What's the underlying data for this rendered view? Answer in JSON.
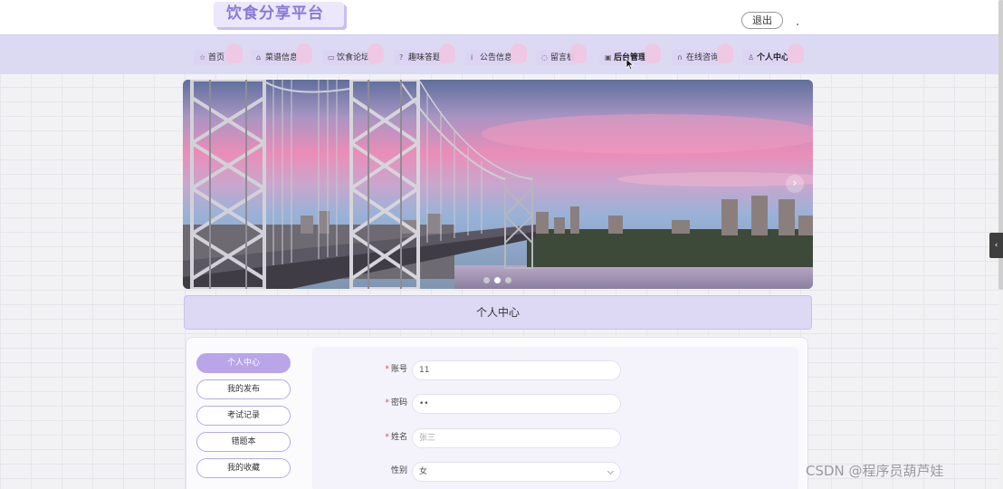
{
  "header": {
    "logo_text": "饮食分享平台",
    "logout_label": "退出"
  },
  "nav": {
    "items": [
      {
        "icon": "star-icon",
        "glyph": "☆",
        "label": "首页"
      },
      {
        "icon": "home-icon",
        "glyph": "⌂",
        "label": "菜谱信息"
      },
      {
        "icon": "chat-icon",
        "glyph": "▭",
        "label": "饮食论坛"
      },
      {
        "icon": "question-icon",
        "glyph": "?",
        "label": "趣味答题"
      },
      {
        "icon": "info-icon",
        "glyph": "i",
        "label": "公告信息"
      },
      {
        "icon": "message-icon",
        "glyph": "◌",
        "label": "留言板"
      },
      {
        "icon": "admin-icon",
        "glyph": "▣",
        "label": "后台管理"
      },
      {
        "icon": "service-icon",
        "glyph": "∩",
        "label": "在线咨询"
      },
      {
        "icon": "user-icon",
        "glyph": "♙",
        "label": "个人中心"
      }
    ]
  },
  "banner": {
    "next_arrow": "›",
    "dots": 3,
    "active_dot": 2
  },
  "section": {
    "title": "个人中心"
  },
  "sidebar": {
    "items": [
      {
        "label": "个人中心",
        "active": true
      },
      {
        "label": "我的发布",
        "active": false
      },
      {
        "label": "考试记录",
        "active": false
      },
      {
        "label": "错题本",
        "active": false
      },
      {
        "label": "我的收藏",
        "active": false
      }
    ]
  },
  "form": {
    "fields": [
      {
        "label": "账号",
        "required": true,
        "value": "11"
      },
      {
        "label": "密码",
        "required": true,
        "value": "••"
      },
      {
        "label": "姓名",
        "required": true,
        "value": "张三"
      },
      {
        "label": "性别",
        "required": false,
        "value": "女"
      }
    ]
  },
  "right_toggle": "‹",
  "watermark": "CSDN @程序员葫芦娃",
  "colors": {
    "accent": "#b9a5e8",
    "nav_bg": "#dcdaf3",
    "logo_text": "#8a7ad6",
    "required": "#e24b4b"
  }
}
